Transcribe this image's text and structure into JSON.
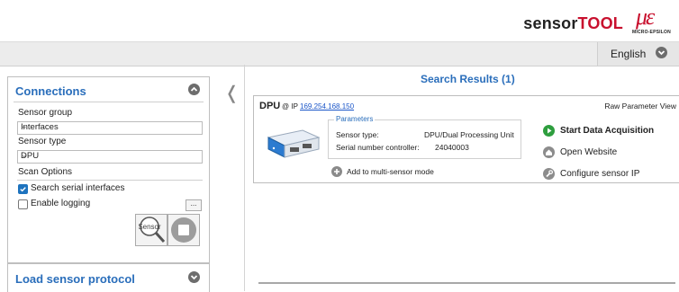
{
  "header": {
    "brand_prefix": "sensor",
    "brand_suffix": "TOOL",
    "logo_mark": "μɛ",
    "logo_text": "MICRO-EPSILON"
  },
  "language": {
    "selected": "English"
  },
  "connections": {
    "title": "Connections",
    "sensor_group_label": "Sensor group",
    "sensor_group_value": "Interfaces",
    "sensor_type_label": "Sensor type",
    "sensor_type_value": "DPU",
    "scan_options_label": "Scan Options",
    "search_serial_label": "Search serial interfaces",
    "search_serial_checked": true,
    "enable_logging_label": "Enable logging",
    "enable_logging_checked": false,
    "more_label": "...",
    "scan_button_label": "Sensor"
  },
  "load_protocol": {
    "title": "Load sensor protocol"
  },
  "results": {
    "title": "Search Results (1)",
    "device": {
      "name": "DPU",
      "ip_prefix": "@ IP",
      "ip": "169.254.168.150",
      "raw_view": "Raw Parameter View",
      "params_title": "Parameters",
      "sensor_type_key": "Sensor type:",
      "sensor_type_val": "DPU/Dual Processing Unit",
      "serial_key": "Serial number controller:",
      "serial_val": "24040003",
      "add_multi": "Add to multi-sensor mode",
      "actions": {
        "start": "Start Data Acquisition",
        "website": "Open Website",
        "configure": "Configure sensor IP"
      }
    }
  },
  "colors": {
    "accent": "#2a6ebb",
    "start_green": "#2e9e3e",
    "brand_red": "#c8102e"
  }
}
